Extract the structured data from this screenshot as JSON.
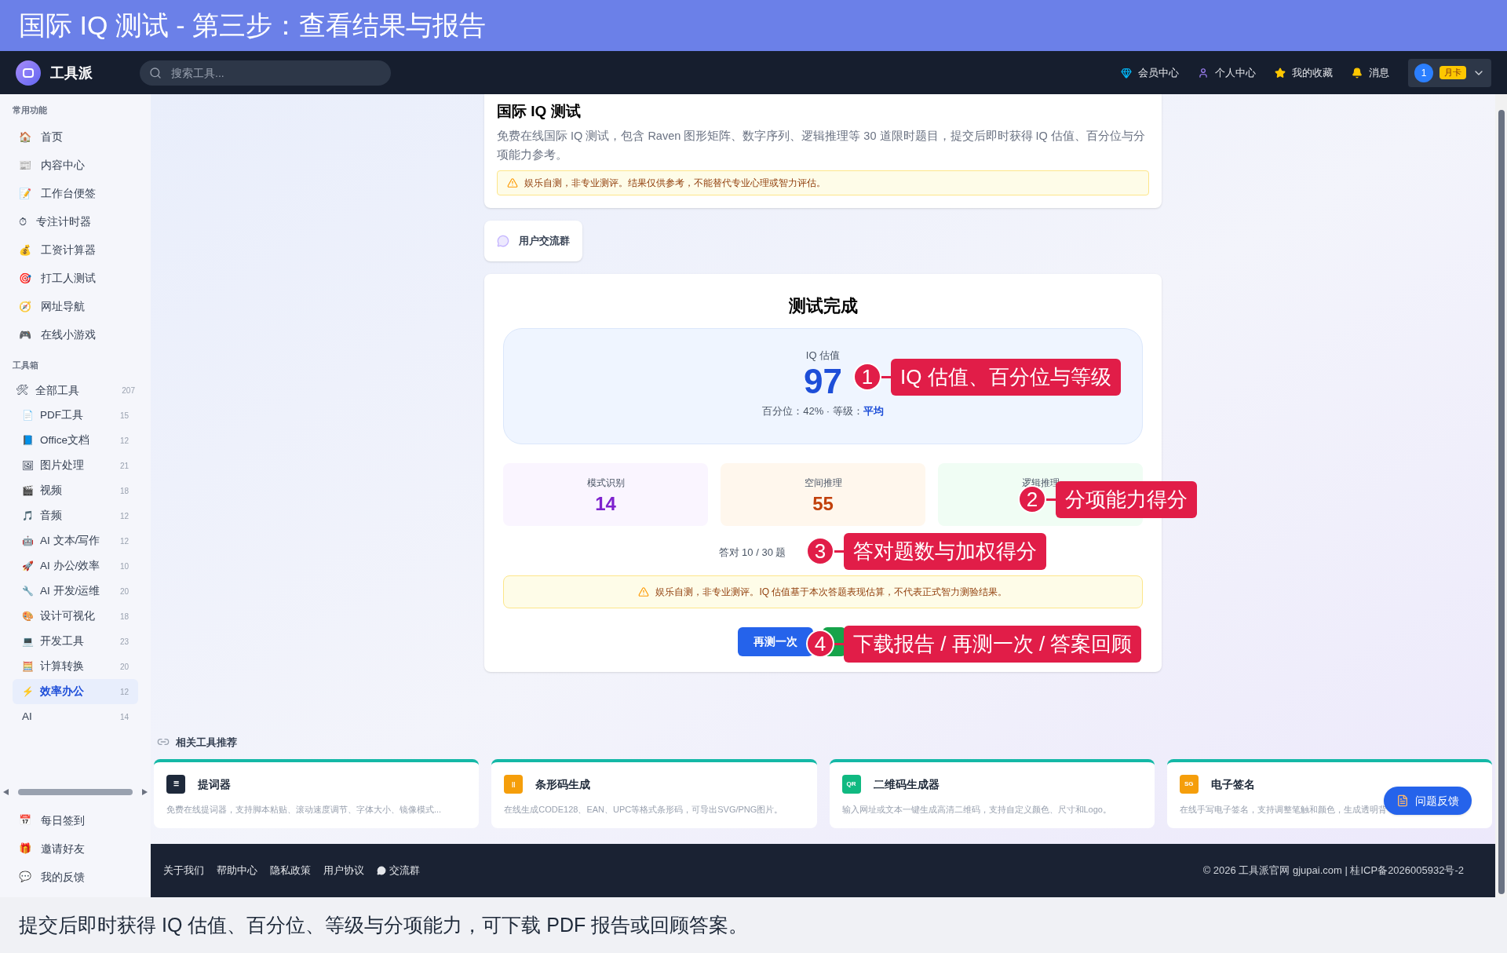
{
  "banner": {
    "title": "国际 IQ 测试 - 第三步：查看结果与报告"
  },
  "navbar": {
    "brand": "工具派",
    "search": {
      "placeholder": "搜索工具..."
    },
    "links": [
      {
        "label": "会员中心"
      },
      {
        "label": "个人中心"
      },
      {
        "label": "我的收藏"
      },
      {
        "label": "消息"
      }
    ],
    "avatar": "1",
    "badge": "月卡"
  },
  "sidebar": {
    "sections": [
      {
        "title": "常用功能",
        "items": [
          {
            "label": "首页",
            "icon": "🏠"
          },
          {
            "label": "内容中心",
            "icon": "📰"
          },
          {
            "label": "工作台便签",
            "icon": "📝"
          },
          {
            "label": "专注计时器",
            "icon": "⏱"
          },
          {
            "label": "工资计算器",
            "icon": "💰"
          },
          {
            "label": "打工人测试",
            "icon": "🎯"
          },
          {
            "label": "网址导航",
            "icon": "🧭"
          },
          {
            "label": "在线小游戏",
            "icon": "🎮"
          }
        ]
      },
      {
        "title": "工具箱",
        "all": {
          "label": "全部工具",
          "icon": "🛠",
          "count": "207"
        },
        "items": [
          {
            "label": "PDF工具",
            "icon": "📄",
            "count": "15",
            "selected": false
          },
          {
            "label": "Office文档",
            "icon": "📘",
            "count": "12",
            "selected": false
          },
          {
            "label": "图片处理",
            "icon": "🖼",
            "count": "21",
            "selected": false
          },
          {
            "label": "视频",
            "icon": "🎬",
            "count": "18",
            "selected": false
          },
          {
            "label": "音频",
            "icon": "🎵",
            "count": "12",
            "selected": false
          },
          {
            "label": "AI 文本/写作",
            "icon": "🤖",
            "count": "12",
            "selected": false
          },
          {
            "label": "AI 办公/效率",
            "icon": "🚀",
            "count": "10",
            "selected": false
          },
          {
            "label": "AI 开发/运维",
            "icon": "🔧",
            "count": "20",
            "selected": false
          },
          {
            "label": "设计可视化",
            "icon": "🎨",
            "count": "18",
            "selected": false
          },
          {
            "label": "开发工具",
            "icon": "💻",
            "count": "23",
            "selected": false
          },
          {
            "label": "计算转换",
            "icon": "🧮",
            "count": "20",
            "selected": false
          },
          {
            "label": "效率办公",
            "icon": "⚡",
            "count": "12",
            "selected": true
          },
          {
            "label": "AI",
            "count": "14",
            "selected": false
          }
        ]
      }
    ],
    "bottom": [
      {
        "label": "每日签到",
        "icon": "📅"
      },
      {
        "label": "邀请好友",
        "icon": "🎁"
      },
      {
        "label": "我的反馈",
        "icon": "💬"
      }
    ]
  },
  "intro": {
    "title": "国际 IQ 测试",
    "description": "免费在线国际 IQ 测试，包含 Raven 图形矩阵、数字序列、逻辑推理等 30 道限时题目，提交后即时获得 IQ 估值、百分位与分项能力参考。",
    "warning": "娱乐自测，非专业测评。结果仅供参考，不能替代专业心理或智力评估。"
  },
  "group_button": "用户交流群",
  "result": {
    "title": "测试完成",
    "iq_label": "IQ 估值",
    "iq_value": "97",
    "percentile": "百分位：42% · 等级：",
    "grade": "平均",
    "scores": [
      {
        "label": "模式识别",
        "value": "14"
      },
      {
        "label": "空间推理",
        "value": "55"
      },
      {
        "label": "逻辑推理"
      }
    ],
    "answered": "答对 10 / 30 题",
    "notice": "娱乐自测，非专业测评。IQ 估值基于本次答题表现估算，不代表正式智力测验结果。",
    "retry": "再测一次"
  },
  "annotations": [
    {
      "number": "1",
      "text": "IQ 估值、百分位与等级"
    },
    {
      "number": "2",
      "text": "分项能力得分"
    },
    {
      "number": "3",
      "text": "答对题数与加权得分"
    },
    {
      "number": "4",
      "text": "下载报告 / 再测一次 / 答案回顾"
    }
  ],
  "related": {
    "title": "相关工具推荐",
    "tools": [
      {
        "name": "提词器",
        "icon": "☰",
        "color": "#1e293b",
        "description": "免费在线提词器，支持脚本粘贴、滚动速度调节、字体大小、镜像模式..."
      },
      {
        "name": "条形码生成",
        "icon": "||",
        "color": "#f59e0b",
        "description": "在线生成CODE128、EAN、UPC等格式条形码，可导出SVG/PNG图片。"
      },
      {
        "name": "二维码生成器",
        "icon": "QR",
        "color": "#10b981",
        "description": "输入网址或文本一键生成高清二维码，支持自定义颜色、尺寸和Logo。"
      },
      {
        "name": "电子签名",
        "icon": "SG",
        "color": "#f59e0b",
        "description": "在线手写电子签名，支持调整笔触和颜色，生成透明背"
      }
    ]
  },
  "feedback_button": "问题反馈",
  "footer": {
    "links": [
      "关于我们",
      "帮助中心",
      "隐私政策",
      "用户协议",
      "交流群"
    ],
    "copyright": "© 2026 工具派官网 gjupai.com | 桂ICP备2026005932号-2"
  },
  "caption": "提交后即时获得 IQ 估值、百分位、等级与分项能力，可下载 PDF 报告或回顾答案。"
}
